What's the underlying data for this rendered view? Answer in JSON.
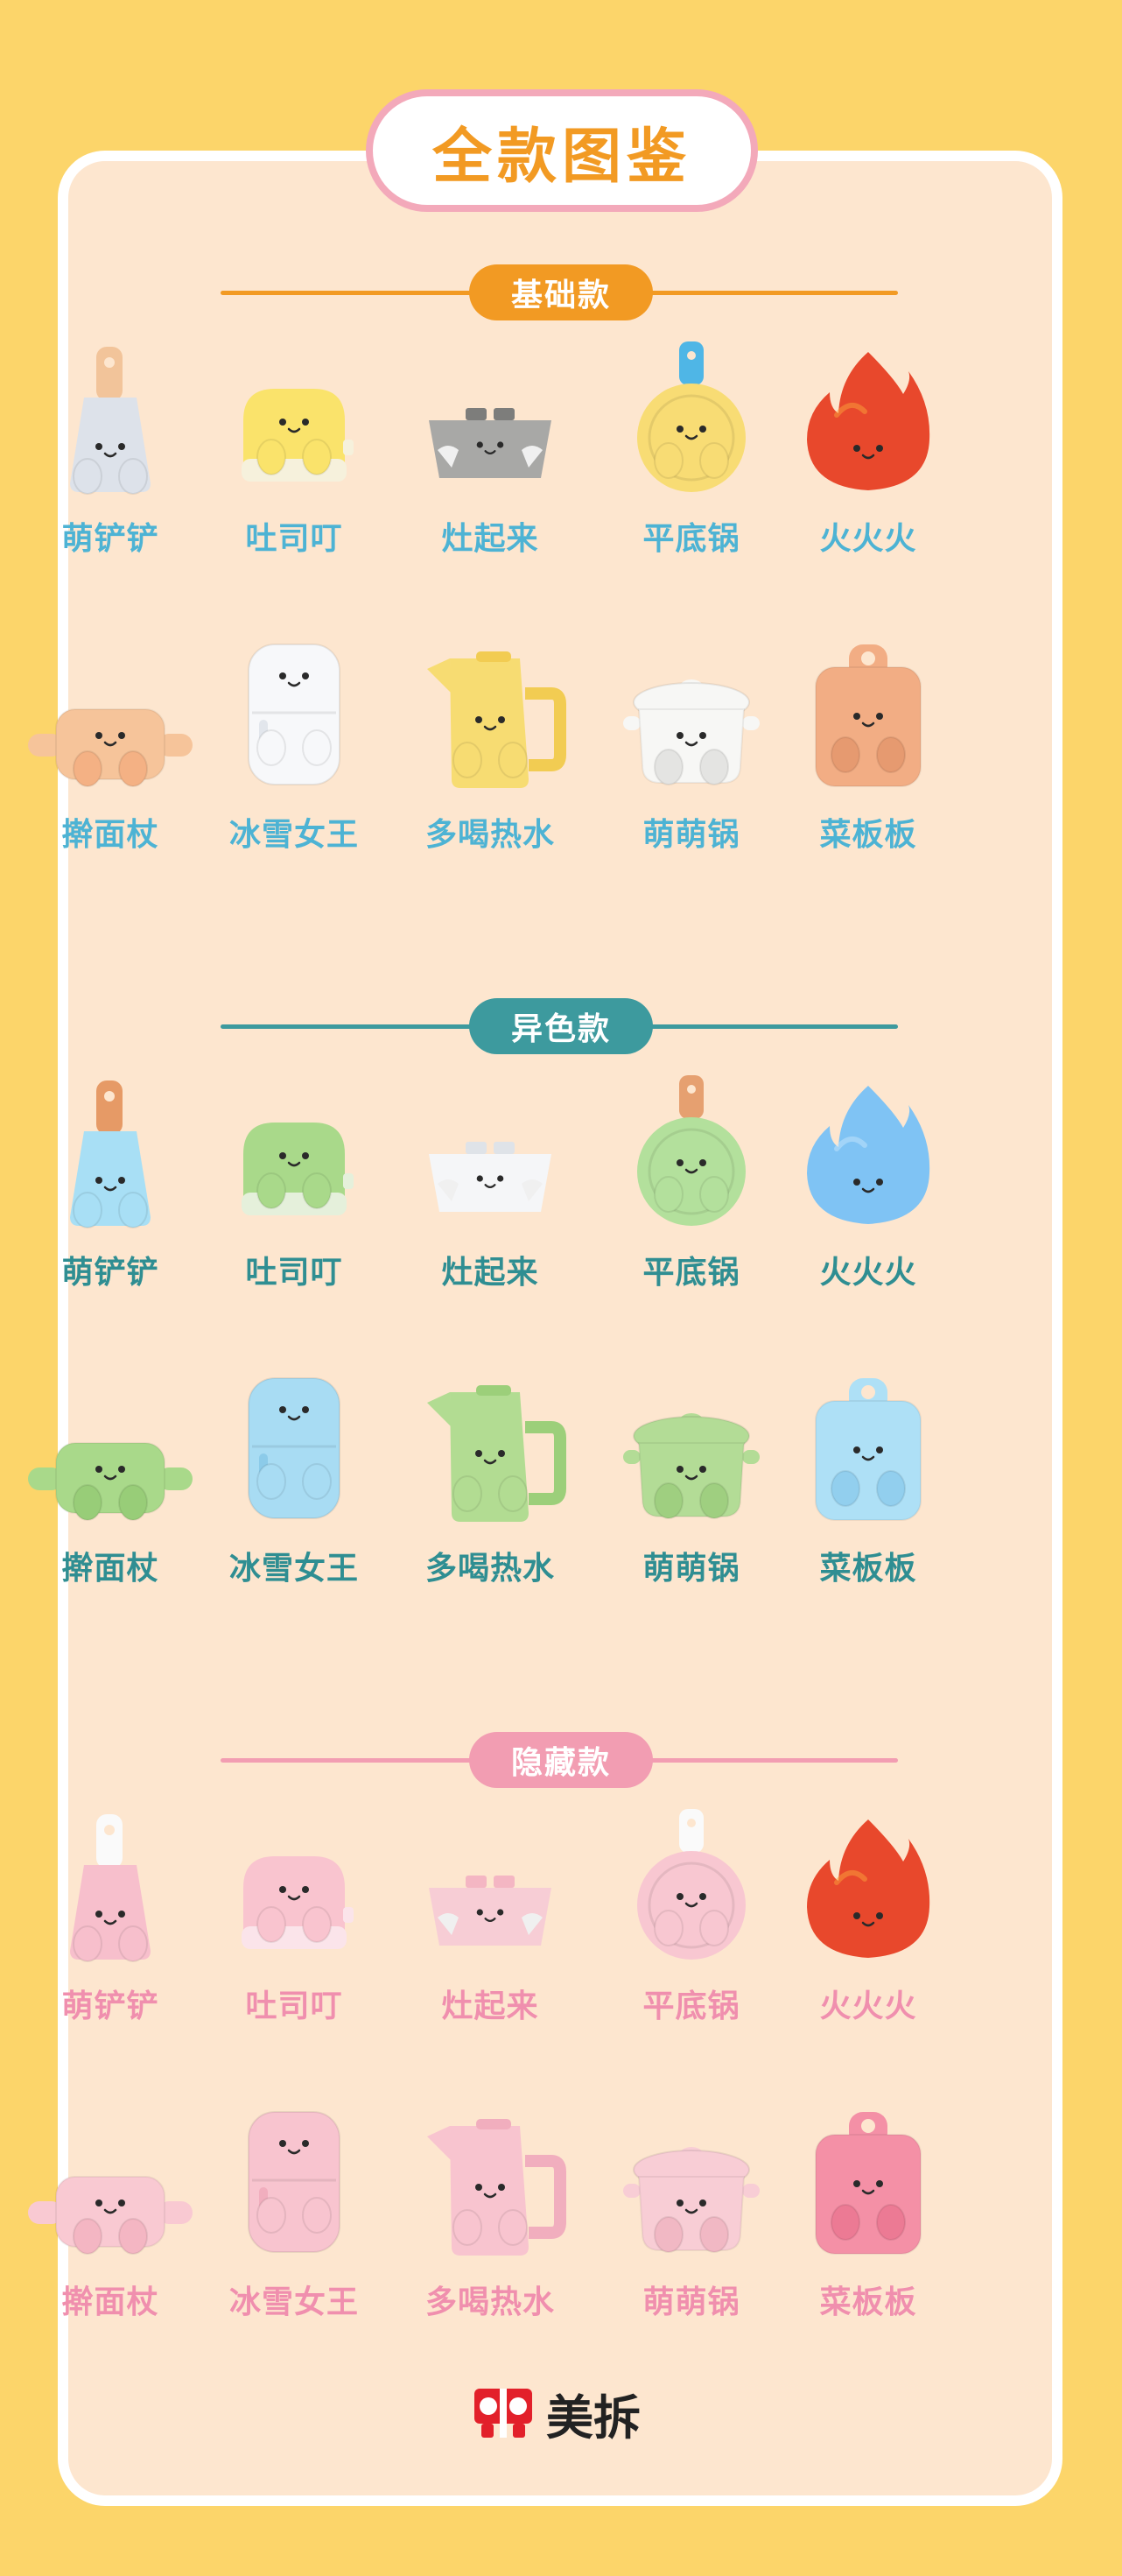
{
  "title": "全款图鉴",
  "brand": {
    "name": "美拆",
    "color": "#e2202a"
  },
  "sections": [
    {
      "name": "基础款",
      "color": "#f29a23",
      "label_color": "#4db3d4",
      "rows": [
        [
          {
            "label": "萌铲铲",
            "icon": "spatula",
            "body": "#dde2ea",
            "accent": "#f2c49a"
          },
          {
            "label": "吐司叮",
            "icon": "toaster",
            "body": "#fae36b",
            "accent": "#f6f1dc"
          },
          {
            "label": "灶起来",
            "icon": "stove",
            "body": "#a8a8a6",
            "accent": "#7d7d7b"
          },
          {
            "label": "平底锅",
            "icon": "pan",
            "body": "#f8dc74",
            "accent": "#4fb6e6"
          },
          {
            "label": "火火火",
            "icon": "fire",
            "body": "#e8482c",
            "accent": "#f9a13a"
          }
        ],
        [
          {
            "label": "擀面杖",
            "icon": "rolling-pin",
            "body": "#f6c49a",
            "accent": "#f4b184"
          },
          {
            "label": "冰雪女王",
            "icon": "fridge",
            "body": "#f7f8fa",
            "accent": "#e2e6ec"
          },
          {
            "label": "多喝热水",
            "icon": "kettle",
            "body": "#f7dc72",
            "accent": "#f2cc52"
          },
          {
            "label": "萌萌锅",
            "icon": "pot",
            "body": "#f7f7f5",
            "accent": "#e4e4e2"
          },
          {
            "label": "菜板板",
            "icon": "board",
            "body": "#f2ad84",
            "accent": "#e69a70"
          }
        ]
      ]
    },
    {
      "name": "异色款",
      "color": "#3d9a9e",
      "label_color": "#2f8e92",
      "rows": [
        [
          {
            "label": "萌铲铲",
            "icon": "spatula",
            "body": "#a8dff5",
            "accent": "#e69a66"
          },
          {
            "label": "吐司叮",
            "icon": "toaster",
            "body": "#a9d98a",
            "accent": "#e5f0db"
          },
          {
            "label": "灶起来",
            "icon": "stove",
            "body": "#f5f6f8",
            "accent": "#dfe3e8"
          },
          {
            "label": "平底锅",
            "icon": "pan",
            "body": "#b3e09c",
            "accent": "#e6a070"
          },
          {
            "label": "火火火",
            "icon": "fire",
            "body": "#7fc3f4",
            "accent": "#c6e6fb"
          }
        ],
        [
          {
            "label": "擀面杖",
            "icon": "rolling-pin",
            "body": "#a9d98a",
            "accent": "#98cd78"
          },
          {
            "label": "冰雪女王",
            "icon": "fridge",
            "body": "#a8dcf3",
            "accent": "#8ccbe9"
          },
          {
            "label": "多喝热水",
            "icon": "kettle",
            "body": "#b2dc92",
            "accent": "#9ccf7a"
          },
          {
            "label": "萌萌锅",
            "icon": "pot",
            "body": "#b3dc96",
            "accent": "#9fcf80"
          },
          {
            "label": "菜板板",
            "icon": "board",
            "body": "#aee0f6",
            "accent": "#92cfee"
          }
        ]
      ]
    },
    {
      "name": "隐藏款",
      "color": "#f29db2",
      "label_color": "#f08fae",
      "rows": [
        [
          {
            "label": "萌铲铲",
            "icon": "spatula",
            "body": "#f7bfcc",
            "accent": "#fafafa"
          },
          {
            "label": "吐司叮",
            "icon": "toaster",
            "body": "#f9c4cf",
            "accent": "#fbe4ea"
          },
          {
            "label": "灶起来",
            "icon": "stove",
            "body": "#f7cdd5",
            "accent": "#f4b6c3"
          },
          {
            "label": "平底锅",
            "icon": "pan",
            "body": "#f8c7d1",
            "accent": "#fafafa"
          },
          {
            "label": "火火火",
            "icon": "fire",
            "body": "#e8482c",
            "accent": "#f9a13a"
          }
        ],
        [
          {
            "label": "擀面杖",
            "icon": "rolling-pin",
            "body": "#f9c9d2",
            "accent": "#f4b6c3"
          },
          {
            "label": "冰雪女王",
            "icon": "fridge",
            "body": "#f8c4cf",
            "accent": "#f1aebe"
          },
          {
            "label": "多喝热水",
            "icon": "kettle",
            "body": "#f8c4cf",
            "accent": "#f1aebe"
          },
          {
            "label": "萌萌锅",
            "icon": "pot",
            "body": "#f8cdd5",
            "accent": "#f1b8c4"
          },
          {
            "label": "菜板板",
            "icon": "board",
            "body": "#f490a6",
            "accent": "#ec7a94"
          }
        ]
      ]
    }
  ]
}
